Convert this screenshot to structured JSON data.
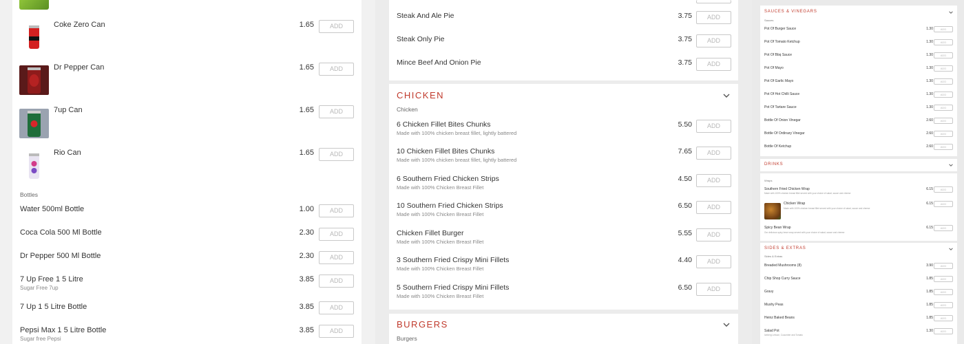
{
  "col1": {
    "image_items": [
      {
        "name": "Coke Zero Can",
        "price": "1.65",
        "add": "ADD",
        "img": "coke-zero-can-image"
      },
      {
        "name": "Dr Pepper Can",
        "price": "1.65",
        "add": "ADD",
        "img": "dr-pepper-can-image"
      },
      {
        "name": "7up Can",
        "price": "1.65",
        "add": "ADD",
        "img": "7up-can-image"
      },
      {
        "name": "Rio Can",
        "price": "1.65",
        "add": "ADD",
        "img": "rio-can-image"
      }
    ],
    "bottles_label": "Bottles",
    "bottles": [
      {
        "name": "Water 500ml Bottle",
        "price": "1.00",
        "add": "ADD"
      },
      {
        "name": "Coca Cola 500 Ml Bottle",
        "price": "2.30",
        "add": "ADD"
      },
      {
        "name": "Dr Pepper 500 Ml Bottle",
        "price": "2.30",
        "add": "ADD"
      },
      {
        "name": "7 Up Free 1 5 Litre",
        "desc": "Sugar Free 7up",
        "price": "3.85",
        "add": "ADD"
      },
      {
        "name": "7 Up 1 5 Litre Bottle",
        "price": "3.85",
        "add": "ADD"
      },
      {
        "name": "Pepsi Max 1 5 Litre Bottle",
        "desc": "Sugar free Pepsi",
        "price": "3.85",
        "add": "ADD"
      }
    ]
  },
  "col2": {
    "pies": [
      {
        "name": "Steak And Ale Pie",
        "price": "3.75",
        "add": "ADD"
      },
      {
        "name": "Steak Only Pie",
        "price": "3.75",
        "add": "ADD"
      },
      {
        "name": "Mince Beef And Onion Pie",
        "price": "3.75",
        "add": "ADD"
      }
    ],
    "chicken": {
      "title": "Chicken",
      "subtitle": "Chicken",
      "items": [
        {
          "name": "6 Chicken Fillet Bites Chunks",
          "desc": "Made with 100% chicken breast fillet, lightly battered",
          "price": "5.50",
          "add": "ADD"
        },
        {
          "name": "10 Chicken Fillet Bites Chunks",
          "desc": "Made with 100% chicken breast fillet, lightly battered",
          "price": "7.65",
          "add": "ADD"
        },
        {
          "name": "6 Southern Fried Chicken Strips",
          "desc": "Made with 100% Chicken Breast Fillet",
          "price": "4.50",
          "add": "ADD"
        },
        {
          "name": "10 Southern Fried Chicken Strips",
          "desc": "Made with 100% Chicken Breast Fillet",
          "price": "6.50",
          "add": "ADD"
        },
        {
          "name": "Chicken Fillet Burger",
          "desc": "Made with 100% Chicken Breast Fillet",
          "price": "5.55",
          "add": "ADD"
        },
        {
          "name": "3 Southern Fried Crispy Mini Fillets",
          "desc": "Made with 100% Chicken Breast Fillet",
          "price": "4.40",
          "add": "ADD"
        },
        {
          "name": "5 Southern Fried Crispy Mini Fillets",
          "desc": "Made with 100% Chicken Breast Fillet",
          "price": "6.50",
          "add": "ADD"
        }
      ]
    },
    "burgers": {
      "title": "Burgers",
      "subtitle": "Burgers"
    }
  },
  "col3": {
    "sauces": {
      "title": "Sauces & Vinegars",
      "subtitle": "Sauces",
      "items": [
        {
          "name": "Pot Of Burger Sauce",
          "price": "1.30",
          "add": "ADD"
        },
        {
          "name": "Pot Of Tomato Ketchup",
          "price": "1.30",
          "add": "ADD"
        },
        {
          "name": "Pot Of Bbq Sauce",
          "price": "1.30",
          "add": "ADD"
        },
        {
          "name": "Pot Of Mayo",
          "price": "1.30",
          "add": "ADD"
        },
        {
          "name": "Pot Of Garlic Mayo",
          "price": "1.30",
          "add": "ADD"
        },
        {
          "name": "Pot Of Hot Chilli Sauce",
          "price": "1.30",
          "add": "ADD"
        },
        {
          "name": "Pot Of Tartare Sauce",
          "price": "1.30",
          "add": "ADD"
        },
        {
          "name": "Bottle Of Onion Vinegar",
          "price": "2.60",
          "add": "ADD"
        },
        {
          "name": "Bottle Of Ordinary Vinegar",
          "price": "2.60",
          "add": "ADD"
        },
        {
          "name": "Bottle Of Ketchup",
          "price": "2.60",
          "add": "ADD"
        }
      ]
    },
    "drinks": {
      "title": "Drinks"
    },
    "wraps": {
      "subtitle": "Wraps",
      "items": [
        {
          "name": "Southern Fried Chicken Wrap",
          "desc": "Made with 100% chicken breast fillet served with your choice of salad, sauce and cheese",
          "price": "6.15",
          "add": "ADD"
        },
        {
          "name": "Chicken Wrap",
          "desc": "Made with 100% chicken breast fillet served with your choice of salad, sauce and cheese",
          "price": "6.15",
          "add": "ADD",
          "img": "chicken-wrap-image"
        },
        {
          "name": "Spicy Bean Wrap",
          "desc": "Our delicious spicy bean wrap served with your choice of salad, sauce and cheese",
          "price": "6.15",
          "add": "ADD"
        }
      ]
    },
    "sides": {
      "title": "Sides & Extras",
      "subtitle": "Sides & Extras",
      "items": [
        {
          "name": "Breaded Mushrooms (8)",
          "price": "3.90",
          "add": "ADD"
        },
        {
          "name": "Chip Shop Curry Sauce",
          "price": "1.85",
          "add": "ADD"
        },
        {
          "name": "Gravy",
          "price": "1.85",
          "add": "ADD"
        },
        {
          "name": "Mushy Peas",
          "price": "1.85",
          "add": "ADD"
        },
        {
          "name": "Heinz Baked Beans",
          "price": "1.85",
          "add": "ADD"
        },
        {
          "name": "Salad Pot",
          "desc": "Iceberg Lettuce, Cucumber and Tomato",
          "price": "1.30",
          "add": "ADD"
        }
      ]
    }
  },
  "colors": {
    "accent": "#c0392b",
    "button_border": "#c8c8c8",
    "button_text": "#b8b8b8",
    "background": "#f1f1f1"
  }
}
